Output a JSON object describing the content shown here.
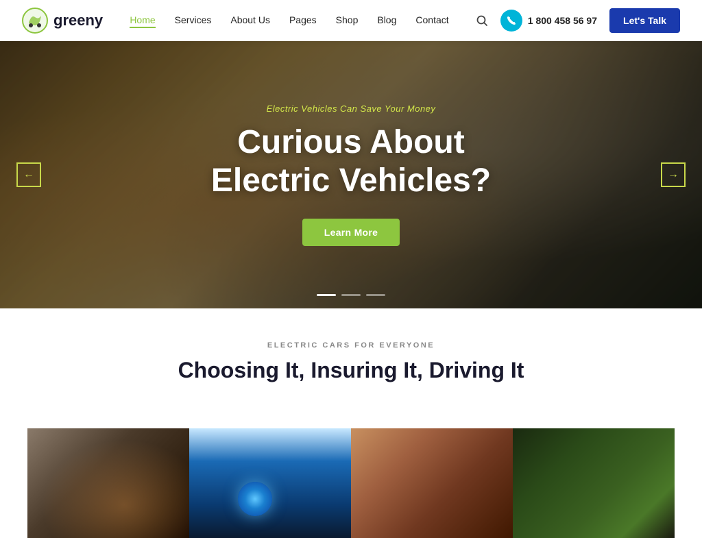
{
  "brand": {
    "name": "greeny",
    "logo_alt": "greeny logo"
  },
  "nav": {
    "links": [
      {
        "label": "Home",
        "active": true
      },
      {
        "label": "Services",
        "active": false
      },
      {
        "label": "About Us",
        "active": false
      },
      {
        "label": "Pages",
        "active": false
      },
      {
        "label": "Shop",
        "active": false
      },
      {
        "label": "Blog",
        "active": false
      },
      {
        "label": "Contact",
        "active": false
      }
    ],
    "phone": "1 800 458 56 97",
    "cta_label": "Let's Talk"
  },
  "hero": {
    "subtitle": "Electric Vehicles Can Save Your Money",
    "title_line1": "Curious About",
    "title_line2": "Electric Vehicles?",
    "cta_label": "Learn More",
    "arrow_left": "←",
    "arrow_right": "→",
    "dots": 3
  },
  "section": {
    "tag": "ELECTRIC CARS FOR EVERYONE",
    "title": "Choosing It, Insuring It, Driving It"
  },
  "cards": [
    {
      "alt": "Electric car charging"
    },
    {
      "alt": "Car charger closeup"
    },
    {
      "alt": "Happy passengers"
    },
    {
      "alt": "Green nature"
    }
  ]
}
